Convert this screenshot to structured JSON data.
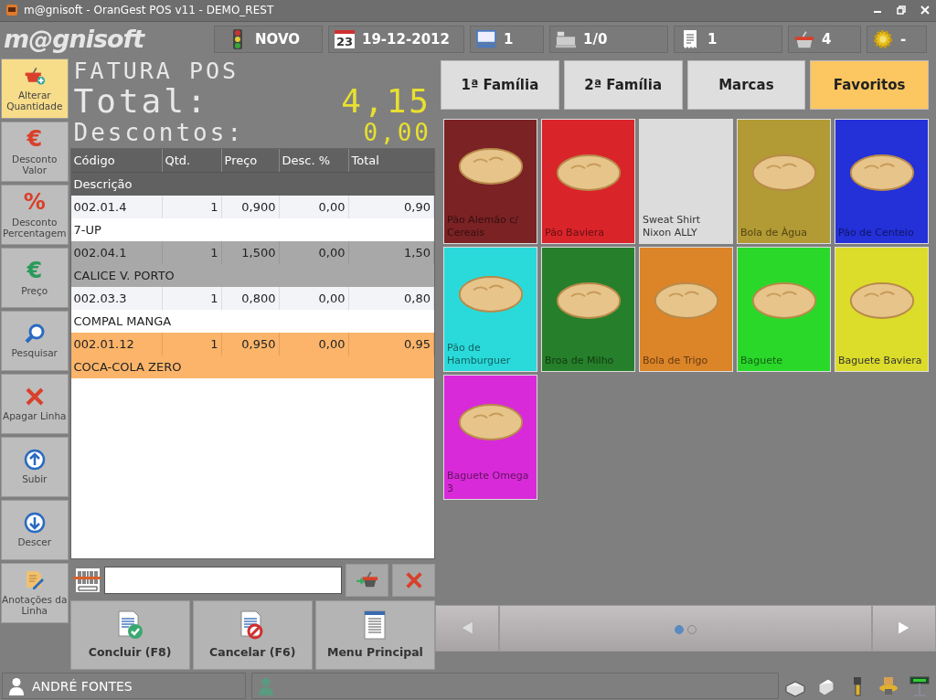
{
  "window": {
    "title": "m@gnisoft - OranGest POS v11 - DEMO_REST"
  },
  "logo": {
    "text": "m@gnisoft"
  },
  "top_bar": [
    {
      "kind": "status",
      "value": "NOVO"
    },
    {
      "kind": "date",
      "day": "23",
      "value": "19-12-2012"
    },
    {
      "kind": "terminal",
      "value": "1"
    },
    {
      "kind": "register",
      "value": "1/0"
    },
    {
      "kind": "receipt",
      "value": "1"
    },
    {
      "kind": "basket",
      "value": "4"
    },
    {
      "kind": "settings",
      "value": "-"
    }
  ],
  "sidebar": [
    {
      "label": "Alterar Quantidade",
      "selected": true
    },
    {
      "label": "Desconto Valor",
      "selected": false,
      "icon": "€"
    },
    {
      "label": "Desconto Percentagem",
      "selected": false,
      "icon": "%"
    },
    {
      "label": "Preço",
      "selected": false,
      "icon": "€"
    },
    {
      "label": "Pesquisar",
      "selected": false
    },
    {
      "label": "Apagar Linha",
      "selected": false
    },
    {
      "label": "Subir",
      "selected": false
    },
    {
      "label": "Descer",
      "selected": false
    },
    {
      "label": "Anotações da Linha",
      "selected": false
    }
  ],
  "display": {
    "title": "FATURA POS",
    "total_label": "Total:",
    "total": "4,15",
    "discount_label": "Descontos:",
    "discount": "0,00"
  },
  "table": {
    "columns": [
      "Código",
      "Qtd.",
      "Preço",
      "Desc. %",
      "Total"
    ],
    "subheader": "Descrição",
    "rows": [
      {
        "code": "002.01.4",
        "qty": "1",
        "price": "0,900",
        "discount": "0,00",
        "total": "0,90",
        "description": "7-UP",
        "selected": false
      },
      {
        "code": "002.04.1",
        "qty": "1",
        "price": "1,500",
        "discount": "0,00",
        "total": "1,50",
        "description": "CALICE V. PORTO",
        "selected": false
      },
      {
        "code": "002.03.3",
        "qty": "1",
        "price": "0,800",
        "discount": "0,00",
        "total": "0,80",
        "description": "COMPAL MANGA",
        "selected": false
      },
      {
        "code": "002.01.12",
        "qty": "1",
        "price": "0,950",
        "discount": "0,00",
        "total": "0,95",
        "description": "COCA-COLA ZERO",
        "selected": true
      }
    ]
  },
  "actions": [
    "Concluir (F8)",
    "Cancelar (F6)",
    "Menu Principal"
  ],
  "tabs": [
    {
      "label": "1ª Família",
      "selected": false
    },
    {
      "label": "2ª Família",
      "selected": false
    },
    {
      "label": "Marcas",
      "selected": false
    },
    {
      "label": "Favoritos",
      "selected": true
    }
  ],
  "products": [
    {
      "name": "Pão Alemão c/ Cereais",
      "color": "#7a2224",
      "photo": true
    },
    {
      "name": "Pão Baviera",
      "color": "#d9242a",
      "photo": true
    },
    {
      "name": "Sweat Shirt Nixon ALLY",
      "color": "#dcdcdc",
      "photo": false
    },
    {
      "name": "Bola de Àgua",
      "color": "#b29a34",
      "photo": true
    },
    {
      "name": "Pão de Centeio",
      "color": "#2430d8",
      "photo": true
    },
    {
      "name": "Pão de Hamburguer",
      "color": "#2adada",
      "photo": true
    },
    {
      "name": "Broa de Milho",
      "color": "#267f2a",
      "photo": true
    },
    {
      "name": "Bola de Trigo",
      "color": "#dc8428",
      "photo": true
    },
    {
      "name": "Baguete",
      "color": "#2ad82a",
      "photo": true
    },
    {
      "name": "Baguete Baviera",
      "color": "#dcdc2a",
      "photo": true
    },
    {
      "name": "Baguete Omega 3",
      "color": "#d82ad8",
      "photo": true
    }
  ],
  "pages": [
    {
      "selected": true
    },
    {
      "selected": false
    }
  ],
  "status_bar": {
    "user": "ANDRÉ FONTES"
  }
}
